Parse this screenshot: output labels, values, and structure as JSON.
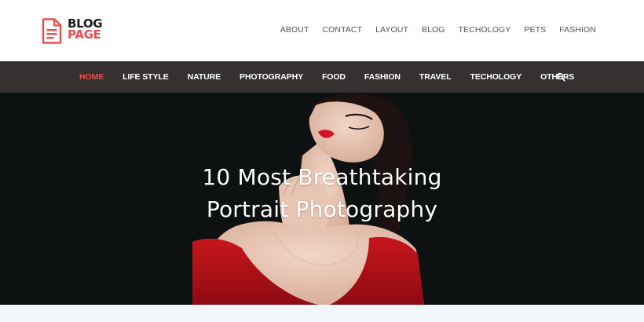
{
  "logo": {
    "line1": "BLOG",
    "line2": "PAGE",
    "icon": "document-icon",
    "accent_color": "#e8504f"
  },
  "top_nav": {
    "items": [
      {
        "label": "ABOUT"
      },
      {
        "label": "CONTACT"
      },
      {
        "label": "LAYOUT"
      },
      {
        "label": "BLOG"
      },
      {
        "label": "TECHOLOGY"
      },
      {
        "label": "PETS"
      },
      {
        "label": "FASHION"
      }
    ]
  },
  "main_nav": {
    "background_color": "#353131",
    "active_color": "#e8504f",
    "items": [
      {
        "label": "HOME",
        "active": true
      },
      {
        "label": "LIFE STYLE"
      },
      {
        "label": "NATURE"
      },
      {
        "label": "PHOTOGRAPHY"
      },
      {
        "label": "FOOD"
      },
      {
        "label": "FASHION"
      },
      {
        "label": "TRAVEL"
      },
      {
        "label": "TECHOLOGY"
      },
      {
        "label": "OTHERS"
      }
    ],
    "search_icon": "search-icon"
  },
  "hero": {
    "title_line1": "10 Most Breathtaking",
    "title_line2": "Portrait Photography"
  }
}
